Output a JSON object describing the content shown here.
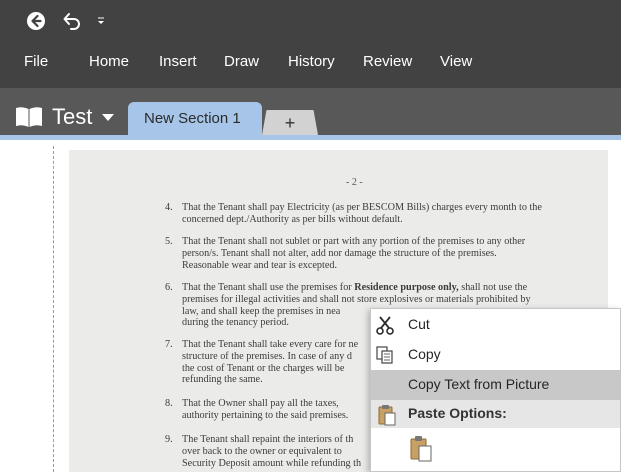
{
  "quick_access": {
    "back_icon": "back-circle-icon",
    "undo_icon": "undo-icon",
    "customize_icon": "dropdown-caret-icon"
  },
  "ribbon_tabs": [
    "File",
    "Home",
    "Insert",
    "Draw",
    "History",
    "Review",
    "View"
  ],
  "notebook": {
    "name": "Test",
    "icon": "notebook-book-icon"
  },
  "sections": {
    "active": "New Section 1",
    "add_label": "+"
  },
  "document": {
    "page_number": "- 2 -",
    "clauses": [
      {
        "num": "4.",
        "lines": [
          "That the Tenant shall pay Electricity (as per BESCOM Bills)  charges every month to the",
          "concerned dept./Authority as per bills without default."
        ]
      },
      {
        "num": "5.",
        "lines": [
          "That the Tenant shall not sublet or part with any portion of the premises to any other",
          "person/s.   Tenant  shall  not  alter,  add  nor  damage  the  structure  of  the  premises.",
          "Reasonable wear and tear is excepted."
        ]
      },
      {
        "num": "6.",
        "lines_html": true,
        "lines": [
          "That the Tenant shall use the premises for Residence purpose only, shall not use the",
          "premises for illegal activities and shall not store explosives or materials prohibited by",
          "law, and shall keep the premises in nea",
          "during the tenancy period."
        ]
      },
      {
        "num": "7.",
        "lines": [
          "That the Tenant shall take every care for ne",
          "structure of the premises.  In case of any d",
          "the cost of Tenant or the charges will be",
          "refunding the same."
        ]
      },
      {
        "num": "8.",
        "lines": [
          "That the Owner shall pay all the taxes,",
          "authority pertaining to the said premises."
        ]
      },
      {
        "num": "9.",
        "lines": [
          "The Tenant shall repaint the interiors of th",
          "over back to the owner or equivalent to",
          "Security Deposit amount while refunding th"
        ]
      }
    ]
  },
  "context_menu": {
    "items": [
      {
        "label": "Cut",
        "icon": "scissors-icon",
        "highlighted": false
      },
      {
        "label": "Copy",
        "icon": "copy-icon",
        "highlighted": false
      },
      {
        "label": "Copy Text from Picture",
        "icon": "",
        "highlighted": true
      }
    ],
    "paste_header": "Paste Options:",
    "paste_icon": "clipboard-icon"
  },
  "colors": {
    "titlebar": "#424242",
    "section_bar": "#585858",
    "active_tab": "#a6c5e8",
    "menu_highlight": "#c8c8c8"
  }
}
